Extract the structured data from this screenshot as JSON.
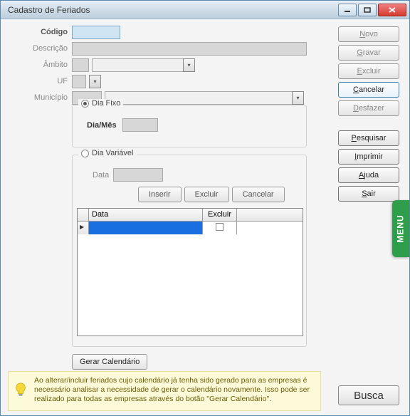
{
  "window": {
    "title": "Cadastro de Feriados"
  },
  "labels": {
    "codigo": "Código",
    "descricao": "Descrição",
    "ambito": "Âmbito",
    "uf": "UF",
    "municipio": "Município",
    "dia_fixo": "Dia Fixo",
    "dia_mes": "Dia/Mês",
    "dia_variavel": "Dia Variável",
    "data": "Data"
  },
  "variavel": {
    "inserir": "Inserir",
    "excluir": "Excluir",
    "cancelar": "Cancelar",
    "grid_cols": {
      "data": "Data",
      "excluir": "Excluir"
    }
  },
  "gerar_calendario": "Gerar Calendário",
  "tip": "Ao alterar/incluir feriados cujo calendário já tenha sido gerado para as empresas é necessário analisar a necessidade de gerar o calendário novamente. Isso pode ser realizado para todas as empresas através do botão \"Gerar Calendário\".",
  "side": {
    "novo": "Novo",
    "gravar": "Gravar",
    "excluir": "Excluir",
    "cancelar": "Cancelar",
    "desfazer": "Desfazer",
    "pesquisar": "Pesquisar",
    "imprimir": "Imprimir",
    "ajuda": "Ajuda",
    "sair": "Sair"
  },
  "menu_tab": "MENU",
  "busca": "Busca"
}
